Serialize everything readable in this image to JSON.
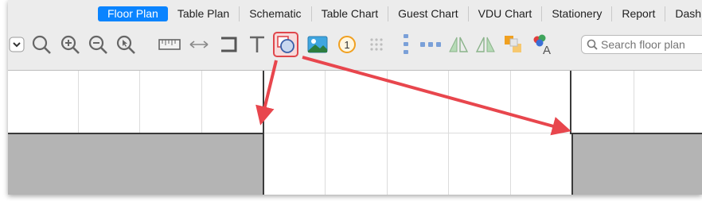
{
  "tabs": [
    {
      "label": "Floor Plan",
      "active": true
    },
    {
      "label": "Table Plan"
    },
    {
      "label": "Schematic"
    },
    {
      "label": "Table Chart"
    },
    {
      "label": "Guest Chart"
    },
    {
      "label": "VDU Chart"
    },
    {
      "label": "Stationery"
    },
    {
      "label": "Report"
    },
    {
      "label": "Dashboard"
    }
  ],
  "toolbar": {
    "items": [
      "dropdown-toggle-icon",
      "zoom-icon",
      "zoom-in-icon",
      "zoom-out-icon",
      "zoom-select-icon",
      "ruler-icon",
      "dimension-icon",
      "wall-icon",
      "text-icon",
      "shape-icon",
      "image-icon",
      "number-icon",
      "grid-icon",
      "vertical-align-icon",
      "horizontal-align-icon",
      "flip-horizontal-icon",
      "flip-vertical-icon",
      "arrange-icon",
      "color-font-icon"
    ],
    "selected": "shape-icon",
    "search_placeholder": "Search floor plan"
  },
  "colors": {
    "accent": "#0a84ff",
    "highlight": "#e0474c",
    "room_fill": "#b4b4b4",
    "annotation_arrow": "#e8464d"
  }
}
